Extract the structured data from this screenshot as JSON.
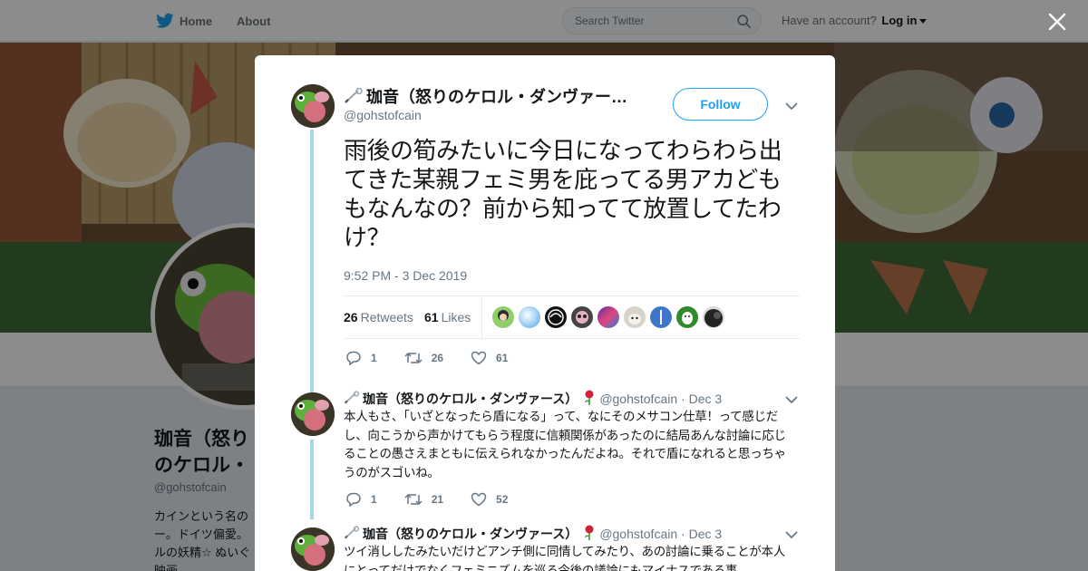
{
  "nav": {
    "home": "Home",
    "about": "About"
  },
  "search": {
    "placeholder": "Search Twitter"
  },
  "account": {
    "prompt": "Have an account?",
    "login": "Log in"
  },
  "profile": {
    "name": "珈音（怒りのケロル・ダンヴァース）",
    "handle": "@gohstofcain",
    "bio": "カインという名の ー。ドイツ偏愛。 ルの妖精☆ ぬいぐ 映画… "
  },
  "tweet": {
    "name": "珈音（怒りのケロル・ダンヴァー…",
    "handle": "@gohstofcain",
    "follow_label": "Follow",
    "text": "雨後の筍みたいに今日になってわらわら出てきた某親フェミ男を庇ってる男アカどももなんなの？前から知ってて放置してたわけ？",
    "timestamp": "9:52 PM - 3 Dec 2019",
    "retweets": "26",
    "retweets_label": "Retweets",
    "likes": "61",
    "likes_label": "Likes",
    "actions": {
      "replies": "1",
      "retweets": "26",
      "likes": "61"
    }
  },
  "replies": [
    {
      "name": "珈音（怒りのケロル・ダンヴァース）",
      "handle": "@gohstofcain",
      "date": "· Dec 3",
      "text": "本人もさ、「いざとなったら盾になる」って、なにそのメサコン仕草！って感じだし、向こうから声かけてもらう程度に信頼関係があったのに結局あんな討論に応じることの愚さえまともに伝えられなかったんだよね。それで盾になれると思っちゃうのがスゴいね。",
      "actions": {
        "replies": "1",
        "retweets": "21",
        "likes": "52"
      }
    },
    {
      "name": "珈音（怒りのケロル・ダンヴァース）",
      "handle": "@gohstofcain",
      "date": "· Dec 3",
      "text": "ツイ消ししたみたいだけどアンチ側に同情してみたり、あの討論に乗ることが本人にとってだけでなくフェミニズムを巡る今後の議論にもマイナスである事"
    }
  ],
  "colors": {
    "accent": "#1da1f2",
    "thread": "#a4d9e9",
    "muted": "#657786"
  }
}
